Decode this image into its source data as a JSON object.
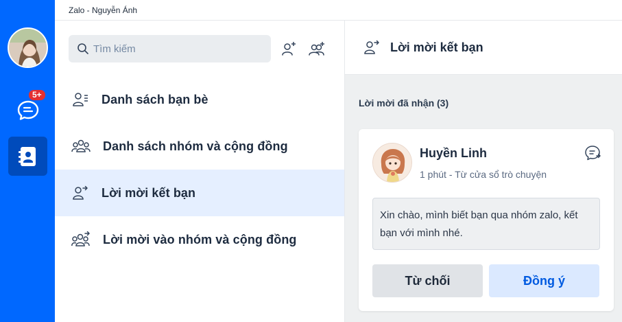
{
  "window": {
    "title": "Zalo - Nguyễn Ánh"
  },
  "rail": {
    "messages_badge": "5+",
    "accent": "#0068ff"
  },
  "search": {
    "placeholder": "Tìm kiếm"
  },
  "sidebar": {
    "items": [
      {
        "label": "Danh sách bạn bè",
        "icon": "friend-list-icon"
      },
      {
        "label": "Danh sách nhóm và cộng đồng",
        "icon": "group-list-icon"
      },
      {
        "label": "Lời mời kết bạn",
        "icon": "friend-request-icon",
        "active": true
      },
      {
        "label": "Lời mời vào nhóm và cộng đồng",
        "icon": "group-invite-icon"
      }
    ]
  },
  "main": {
    "title": "Lời mời kết bạn",
    "section_title": "Lời mời đã nhận (3)",
    "request": {
      "name": "Huyền Linh",
      "subtitle": "1 phút - Từ cửa sổ trò chuyện",
      "message": "Xin chào, mình biết bạn qua nhóm zalo, kết bạn với mình nhé.",
      "reject_label": "Từ chối",
      "accept_label": "Đồng ý"
    }
  }
}
